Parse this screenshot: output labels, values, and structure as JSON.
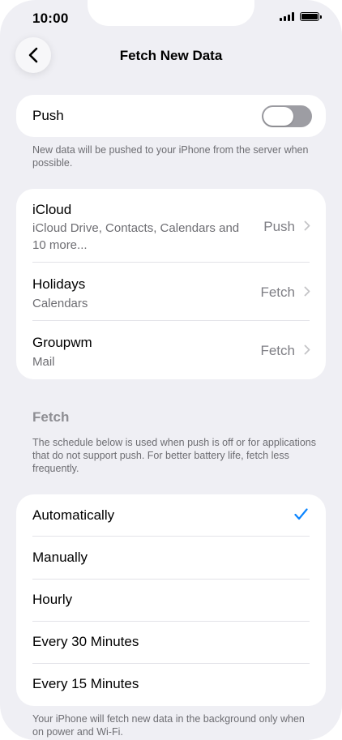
{
  "status_bar": {
    "time": "10:00"
  },
  "nav": {
    "title": "Fetch New Data"
  },
  "push": {
    "label": "Push",
    "enabled": false,
    "footnote": "New data will be pushed to your iPhone from the server when possible."
  },
  "accounts": [
    {
      "title": "iCloud",
      "subtitle": "iCloud Drive, Contacts, Calendars and 10 more...",
      "value": "Push"
    },
    {
      "title": "Holidays",
      "subtitle": "Calendars",
      "value": "Fetch"
    },
    {
      "title": "Groupwm",
      "subtitle": "Mail",
      "value": "Fetch"
    }
  ],
  "fetch": {
    "header": "Fetch",
    "description": "The schedule below is used when push is off or for applications that do not support push. For better battery life, fetch less frequently.",
    "options": [
      {
        "label": "Automatically",
        "selected": true
      },
      {
        "label": "Manually",
        "selected": false
      },
      {
        "label": "Hourly",
        "selected": false
      },
      {
        "label": "Every 30 Minutes",
        "selected": false
      },
      {
        "label": "Every 15 Minutes",
        "selected": false
      }
    ],
    "footnote": "Your iPhone will fetch new data in the background only when on power and Wi-Fi."
  },
  "colors": {
    "accent": "#0a84ff",
    "background": "#efeff4",
    "secondary_text": "#6d6d72",
    "toggle_off": "#9d9da3"
  },
  "icons": {
    "back": "chevron-left-icon",
    "disclosure": "chevron-right-icon",
    "selected": "checkmark-icon"
  }
}
